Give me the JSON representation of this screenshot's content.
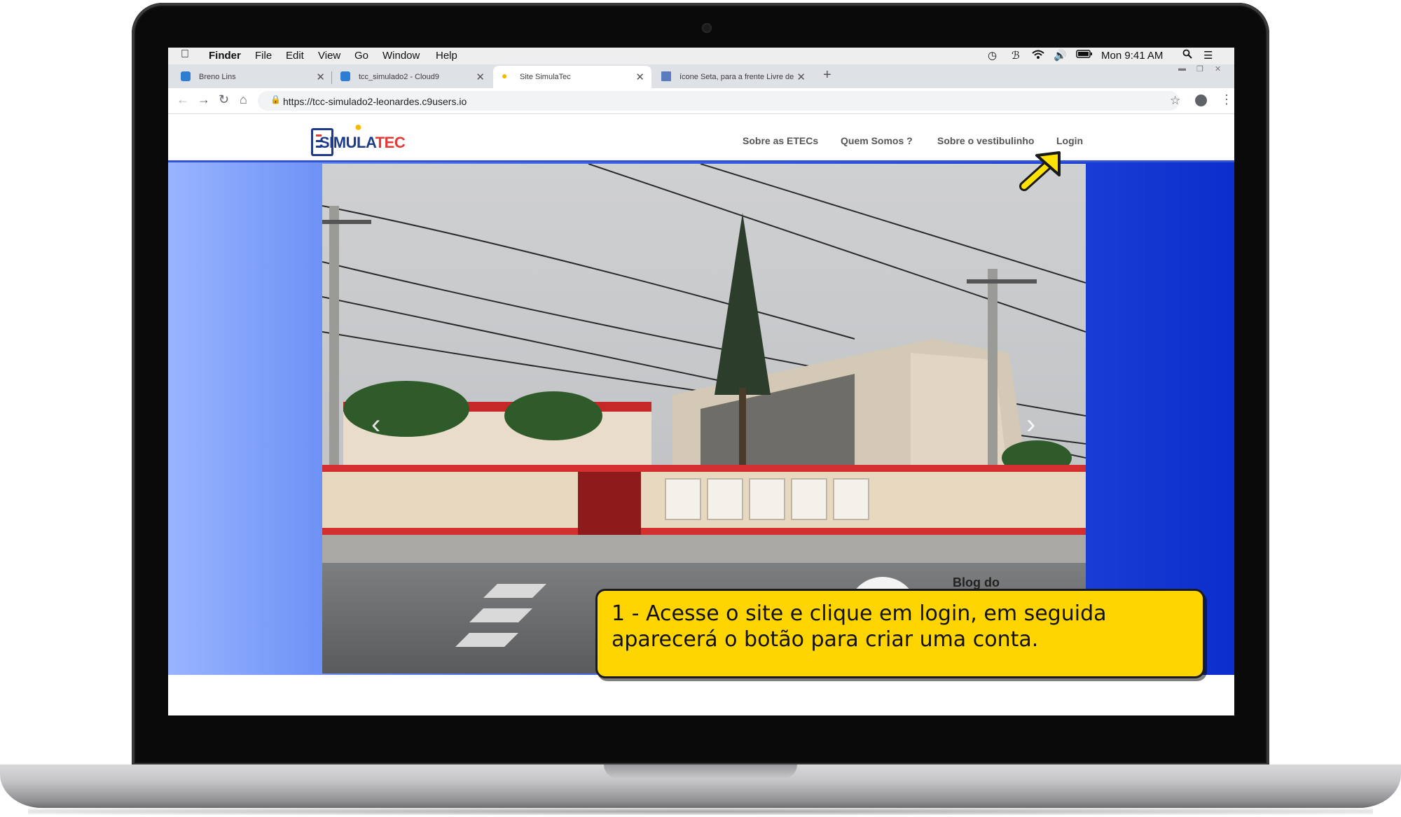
{
  "menubar": {
    "app": "Finder",
    "items": [
      "File",
      "Edit",
      "View",
      "Go",
      "Window",
      "Help"
    ],
    "clock": "Mon 9:41 AM"
  },
  "tabs": [
    {
      "label": "Breno Lins",
      "icon": "cloud9-icon",
      "color": "#2d7dd2"
    },
    {
      "label": "tcc_simulado2 - Cloud9",
      "icon": "cloud9-icon",
      "color": "#2d7dd2"
    },
    {
      "label": "Site SimulaTec",
      "icon": "lightbulb-icon",
      "color": "#f6b800",
      "active": true
    },
    {
      "label": "ícone Seta, para a frente Livre de M",
      "icon": "page-icon",
      "color": "#5a7bbf"
    }
  ],
  "browser": {
    "url": "https://tcc-simulado2-leonardes.c9users.io"
  },
  "site": {
    "logo_main": "SIMULA",
    "logo_accent": "TEC",
    "nav": [
      "Sobre as ETECs",
      "Quem Somos ?",
      "Sobre o vestibulinho",
      "Login"
    ],
    "photo_caption": "Blog do",
    "accent_color": "#3154d6"
  },
  "annotation": {
    "text": "1 - Acesse o site e clique em login, em seguida aparecerá o botão para criar uma conta.",
    "background": "#ffd500"
  }
}
